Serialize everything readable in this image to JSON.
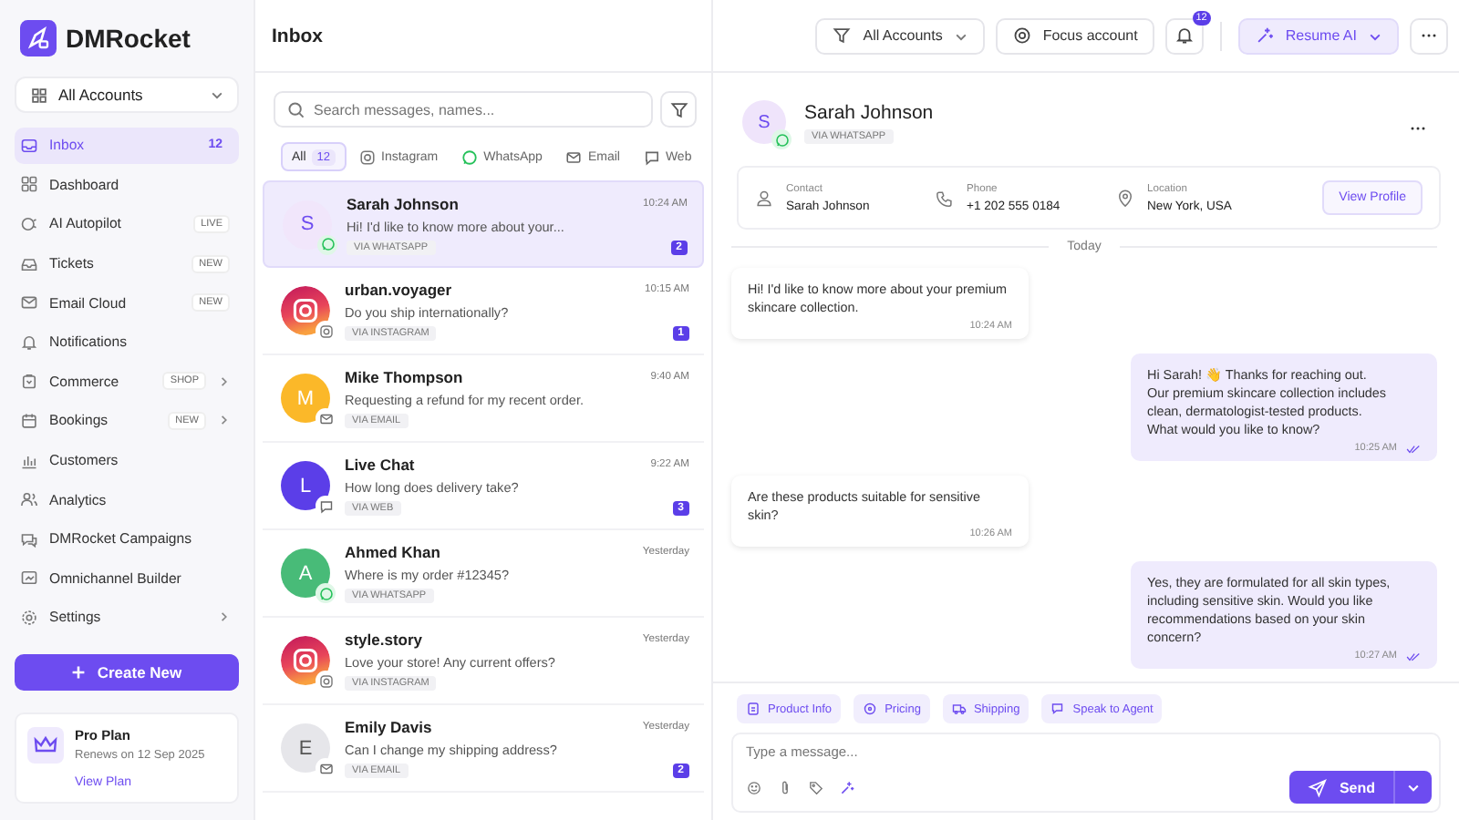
{
  "sidebar": {
    "brand": "DMRocket",
    "account_select": "All Accounts",
    "nav": [
      {
        "label": "Inbox",
        "badge": {
          "text": "12",
          "kind": "count"
        },
        "selected": true,
        "submenu": false
      },
      {
        "label": "Dashboard",
        "selected": false,
        "submenu": false
      },
      {
        "label": "AI Autopilot",
        "badge": {
          "text": "LIVE",
          "kind": "tag"
        },
        "selected": false,
        "submenu": false
      },
      {
        "label": "Tickets",
        "badge": {
          "text": "NEW",
          "kind": "tag"
        },
        "selected": false,
        "submenu": false
      },
      {
        "label": "Email Cloud",
        "badge": {
          "text": "NEW",
          "kind": "tag"
        },
        "selected": false,
        "submenu": false
      },
      {
        "label": "Notifications",
        "selected": false,
        "submenu": false
      },
      {
        "label": "Commerce",
        "badge": {
          "text": "SHOP",
          "kind": "tag"
        },
        "selected": false,
        "submenu": true
      },
      {
        "label": "Bookings",
        "badge": {
          "text": "NEW",
          "kind": "tag"
        },
        "selected": false,
        "submenu": true
      },
      {
        "label": "Customers",
        "selected": false,
        "submenu": false
      },
      {
        "label": "Analytics",
        "selected": false,
        "submenu": false
      },
      {
        "label": "DMRocket Campaigns",
        "selected": false,
        "submenu": false
      },
      {
        "label": "Omnichannel Builder",
        "selected": false,
        "submenu": false
      },
      {
        "label": "Settings",
        "selected": false,
        "submenu": true
      }
    ],
    "create_button": "Create New",
    "plan": {
      "title": "Pro Plan",
      "renewal": "Renews on 12 Sep 2025",
      "link": "View Plan"
    }
  },
  "inbox": {
    "title": "Inbox",
    "search": {
      "placeholder": "Search messages, names..."
    },
    "filters": [
      {
        "label": "All",
        "count": "12",
        "kind": "all",
        "selected": true
      },
      {
        "label": "Instagram",
        "kind": "instagram",
        "selected": false
      },
      {
        "label": "WhatsApp",
        "kind": "whatsapp",
        "selected": false
      },
      {
        "label": "Email",
        "kind": "email",
        "selected": false
      },
      {
        "label": "Web",
        "kind": "web",
        "selected": false
      }
    ],
    "conversations": [
      {
        "name": "Sarah Johnson",
        "preview": "Hi! I'd like to know more about your...",
        "via": "VIA WHATSAPP",
        "channel_badge": {
          "kind": "whatsapp"
        },
        "time": "10:24 AM",
        "unread": "2",
        "selected": true,
        "avatar": {
          "kind": "letter",
          "initial": "S",
          "color": "#f1e6fb"
        }
      },
      {
        "name": "urban.voyager",
        "preview": "Do you ship internationally?",
        "via": "VIA INSTAGRAM",
        "channel_badge": {
          "kind": "instagram"
        },
        "time": "10:15 AM",
        "unread": "1",
        "selected": false,
        "avatar": {
          "kind": "instagram"
        }
      },
      {
        "name": "Mike Thompson",
        "preview": "Requesting a refund for my recent order.",
        "via": "VIA EMAIL",
        "channel_badge": {
          "kind": "email"
        },
        "time": "9:40 AM",
        "selected": false,
        "avatar": {
          "kind": "letter",
          "initial": "M",
          "color": "#fbb829"
        }
      },
      {
        "name": "Live Chat",
        "preview": "How long does delivery take?",
        "via": "VIA WEB",
        "channel_badge": {
          "kind": "web"
        },
        "time": "9:22 AM",
        "unread": "3",
        "selected": false,
        "avatar": {
          "kind": "letter",
          "initial": "L",
          "color": "#5b3ee8"
        }
      },
      {
        "name": "Ahmed Khan",
        "preview": "Where is my order #12345?",
        "via": "VIA WHATSAPP",
        "channel_badge": {
          "kind": "whatsapp"
        },
        "time": "Yesterday",
        "selected": false,
        "avatar": {
          "kind": "letter",
          "initial": "A",
          "color": "#48bb78"
        }
      },
      {
        "name": "style.story",
        "preview": "Love your store! Any current offers?",
        "via": "VIA INSTAGRAM",
        "channel_badge": {
          "kind": "instagram"
        },
        "time": "Yesterday",
        "selected": false,
        "avatar": {
          "kind": "instagram"
        }
      },
      {
        "name": "Emily Davis",
        "preview": "Can I change my shipping address?",
        "via": "VIA EMAIL",
        "channel_badge": {
          "kind": "email"
        },
        "time": "Yesterday",
        "unread": "2",
        "selected": false,
        "avatar": {
          "kind": "letter",
          "initial": "E",
          "color": "#e6e6ea"
        }
      }
    ]
  },
  "toolbar": {
    "account_filter": "All Accounts",
    "focus_button": "Focus account",
    "notifications": "12",
    "ai_button": "Resume AI"
  },
  "chat": {
    "name": "Sarah Johnson",
    "via": "VIA WHATSAPP",
    "channel_badge": {
      "kind": "whatsapp"
    },
    "initial": "S",
    "details": [
      {
        "label": "Contact",
        "value": "Sarah Johnson",
        "kind": "person"
      },
      {
        "label": "Phone",
        "value": "+1 202 555 0184",
        "kind": "phone"
      },
      {
        "label": "Location",
        "value": "New York, USA",
        "kind": "location"
      }
    ],
    "profile_button": "View Profile",
    "divider": "Today",
    "messages": [
      {
        "kind": "received",
        "text": "Hi! I'd like to know more about your premium skincare collection.",
        "time": "10:24 AM"
      },
      {
        "kind": "sent",
        "text": "Hi Sarah! 👋 Thanks for reaching out.\nOur premium skincare collection includes clean, dermatologist-tested products.\nWhat would you like to know?",
        "time": "10:25 AM",
        "read": true
      },
      {
        "kind": "received",
        "text": "Are these products suitable for sensitive skin?",
        "time": "10:26 AM"
      },
      {
        "kind": "sent",
        "text": "Yes, they are formulated for all skin types, including sensitive skin. Would you like recommendations based on your skin concern?",
        "time": "10:27 AM",
        "read": true
      }
    ],
    "quick_replies": [
      {
        "label": "Product Info",
        "kind": "info"
      },
      {
        "label": "Pricing",
        "kind": "price"
      },
      {
        "label": "Shipping",
        "kind": "truck"
      },
      {
        "label": "Speak to Agent",
        "kind": "agent"
      }
    ],
    "composer": {
      "placeholder": "Type a message...",
      "send": "Send"
    }
  }
}
